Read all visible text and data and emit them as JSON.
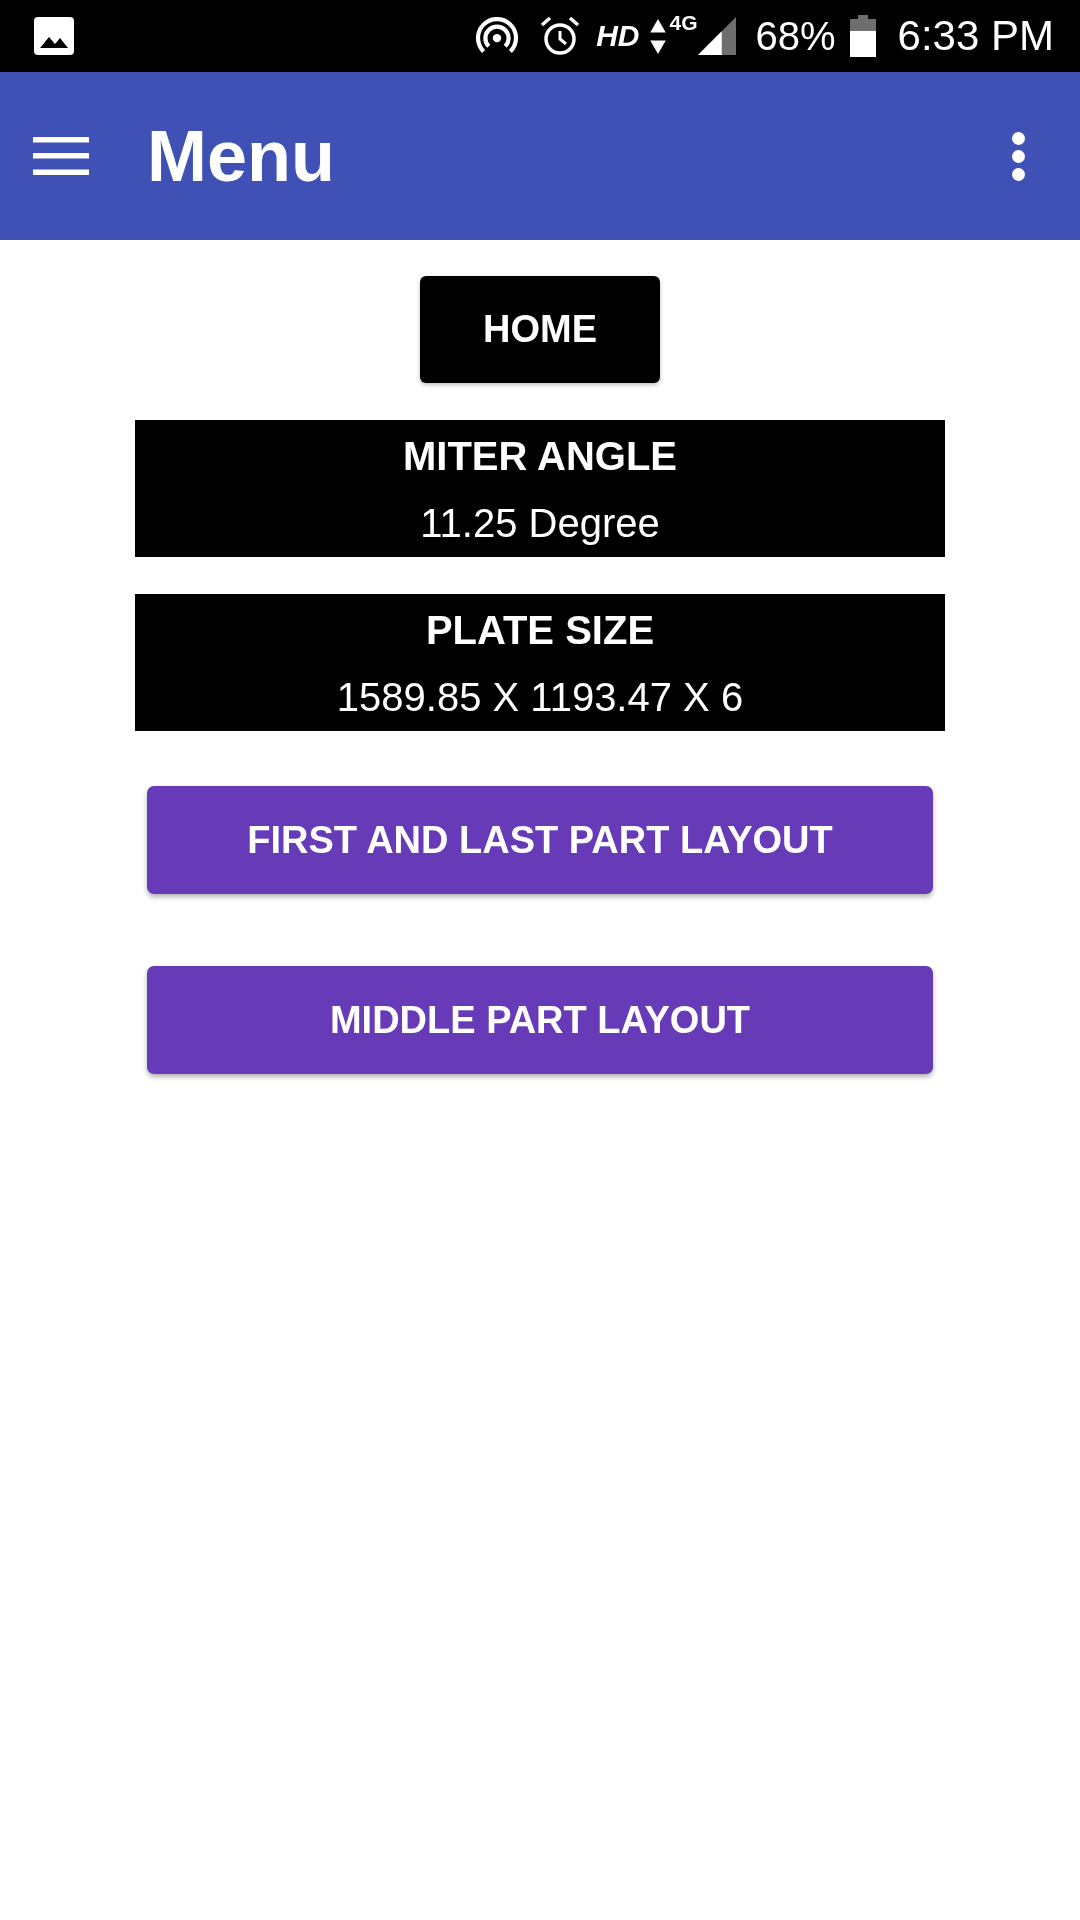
{
  "status_bar": {
    "hd": "HD",
    "network": "4G",
    "battery": "68%",
    "time": "6:33 PM"
  },
  "app_bar": {
    "title": "Menu"
  },
  "home_button": {
    "label": "HOME"
  },
  "info_panels": [
    {
      "heading": "MITER ANGLE",
      "value": "11.25 Degree"
    },
    {
      "heading": "PLATE SIZE",
      "value": "1589.85 X 1193.47 X 6"
    }
  ],
  "buttons": [
    {
      "label": "FIRST AND LAST PART LAYOUT"
    },
    {
      "label": "MIDDLE PART LAYOUT"
    }
  ]
}
